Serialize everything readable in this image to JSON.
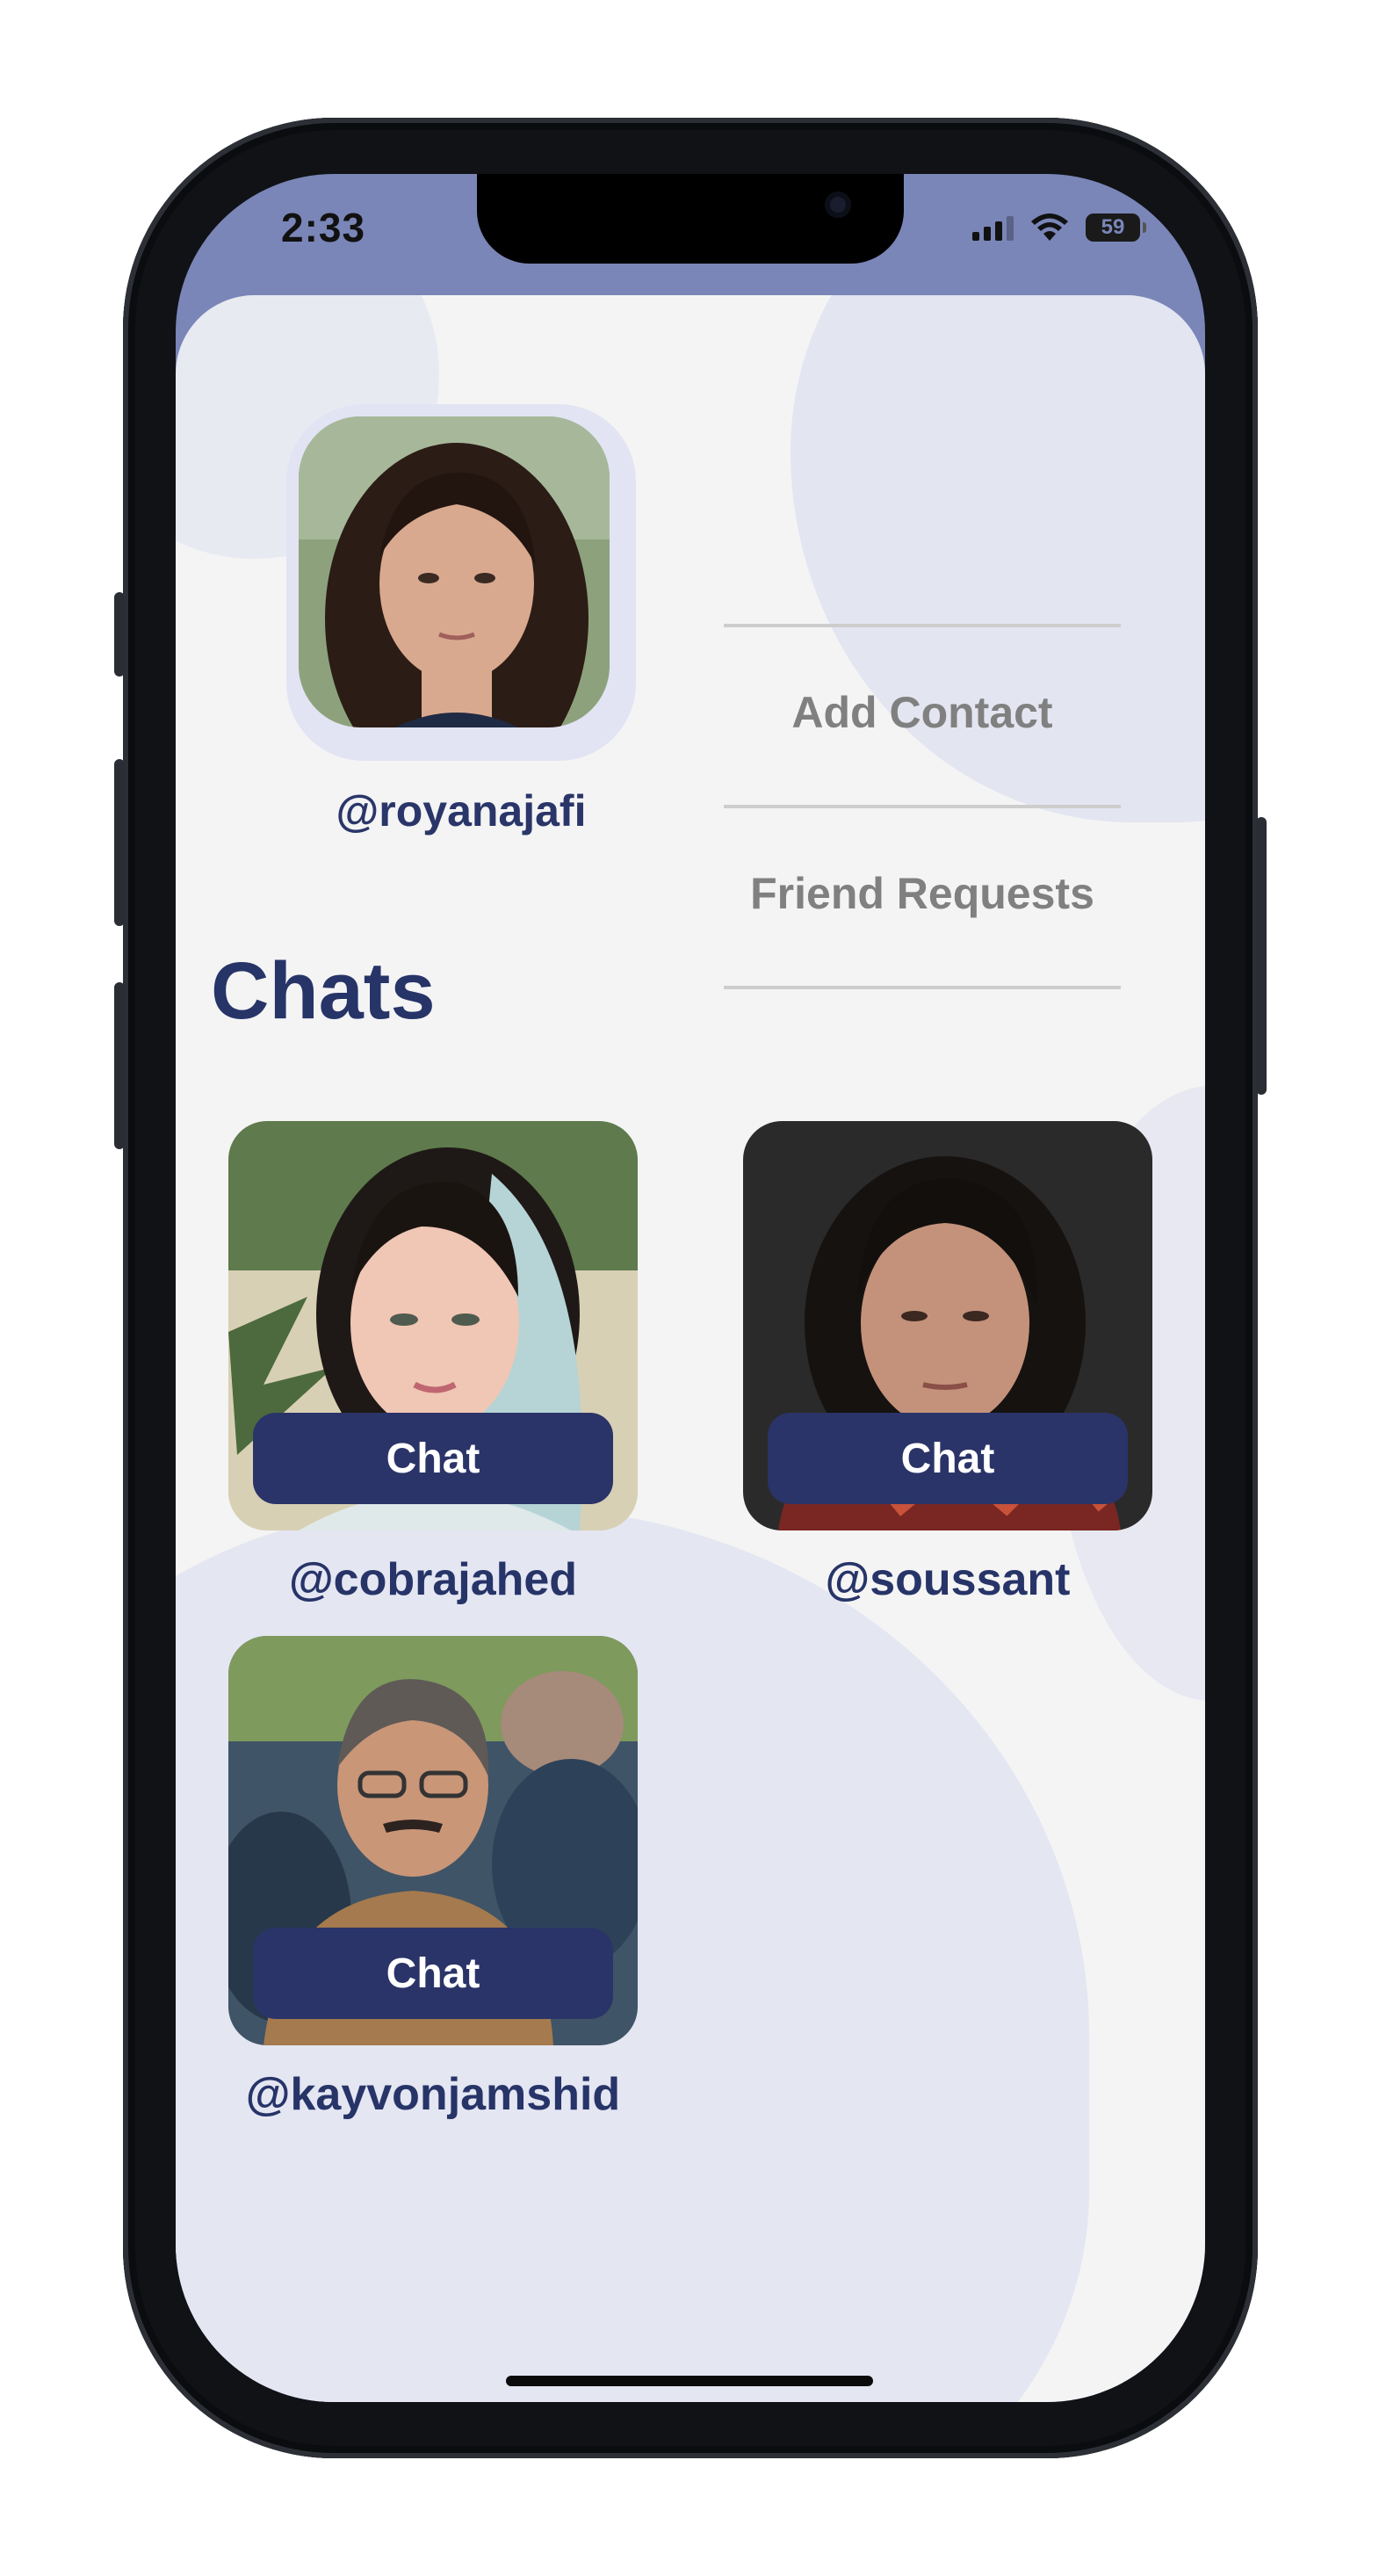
{
  "status_bar": {
    "time": "2:33",
    "battery": "59",
    "icons": [
      "signal-icon",
      "wifi-icon",
      "battery-icon"
    ]
  },
  "profile": {
    "username": "@royanajafi",
    "avatar": "avatar-photo"
  },
  "menu": {
    "add_contact": "Add Contact",
    "friend_requests": "Friend Requests"
  },
  "chats": {
    "title": "Chats",
    "items": [
      {
        "username": "@cobrajahed",
        "button_label": "Chat",
        "avatar": "avatar-photo"
      },
      {
        "username": "@soussant",
        "button_label": "Chat",
        "avatar": "avatar-photo"
      },
      {
        "username": "@kayvonjamshid",
        "button_label": "Chat",
        "avatar": "avatar-photo"
      }
    ]
  },
  "colors": {
    "accent_navy": "#2a3468",
    "status_bar_bg": "#7a86b8",
    "content_bg": "#f4f4f4",
    "blob": "#e3e5f1",
    "menu_text": "#808080"
  }
}
